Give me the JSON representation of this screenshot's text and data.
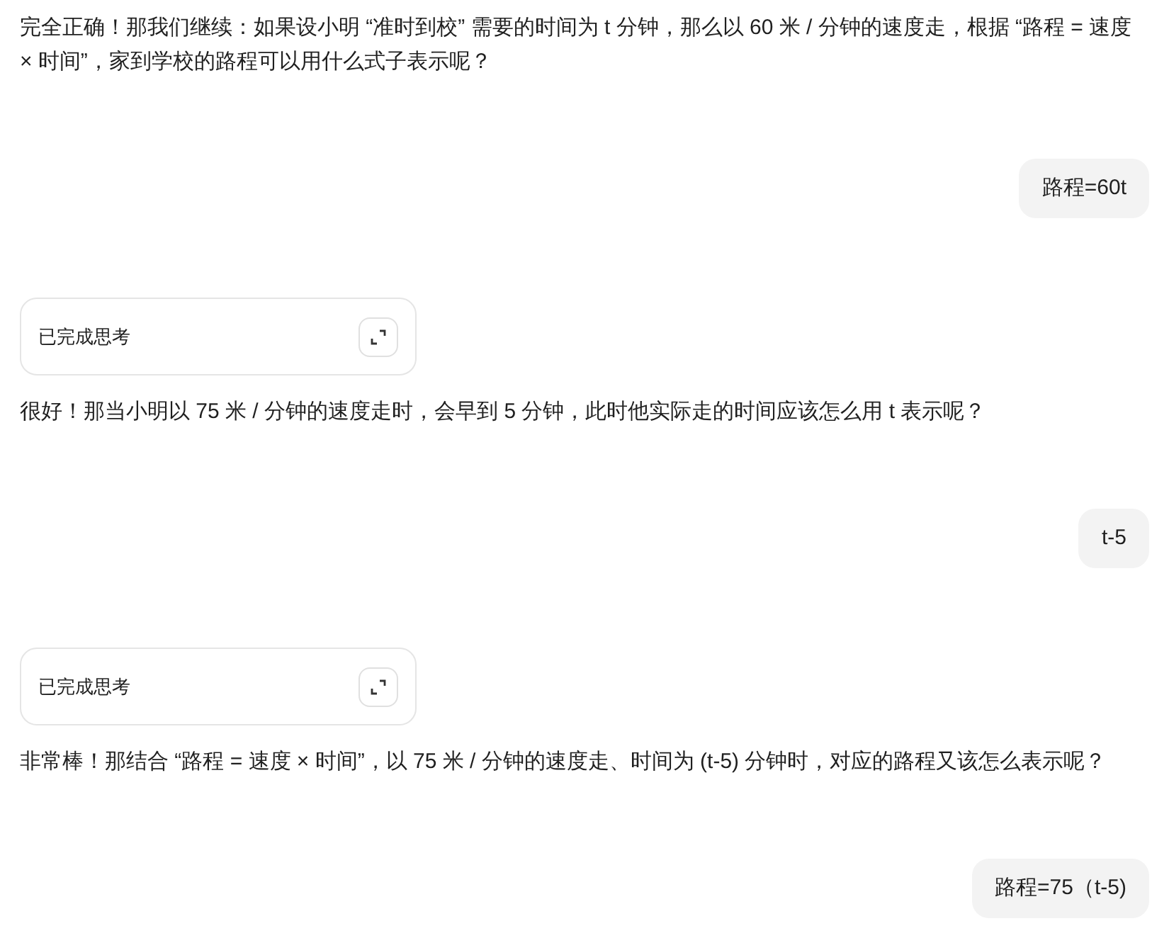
{
  "messages": [
    {
      "kind": "assistant",
      "text": "完全正确！那我们继续：如果设小明 “准时到校” 需要的时间为 t 分钟，那么以 60 米 / 分钟的速度走，根据 “路程 = 速度 × 时间”，家到学校的路程可以用什么式子表示呢？"
    },
    {
      "kind": "user",
      "text": "路程=60t"
    },
    {
      "kind": "thinking",
      "text": "已完成思考"
    },
    {
      "kind": "assistant",
      "text": "很好！那当小明以 75 米 / 分钟的速度走时，会早到 5 分钟，此时他实际走的时间应该怎么用 t 表示呢？"
    },
    {
      "kind": "user",
      "text": "t-5"
    },
    {
      "kind": "thinking",
      "text": "已完成思考"
    },
    {
      "kind": "assistant",
      "text": "非常棒！那结合 “路程 = 速度 × 时间”，以 75 米 / 分钟的速度走、时间为 (t-5) 分钟时，对应的路程又该怎么表示呢？"
    },
    {
      "kind": "user",
      "text": "路程=75（t-5)"
    }
  ]
}
